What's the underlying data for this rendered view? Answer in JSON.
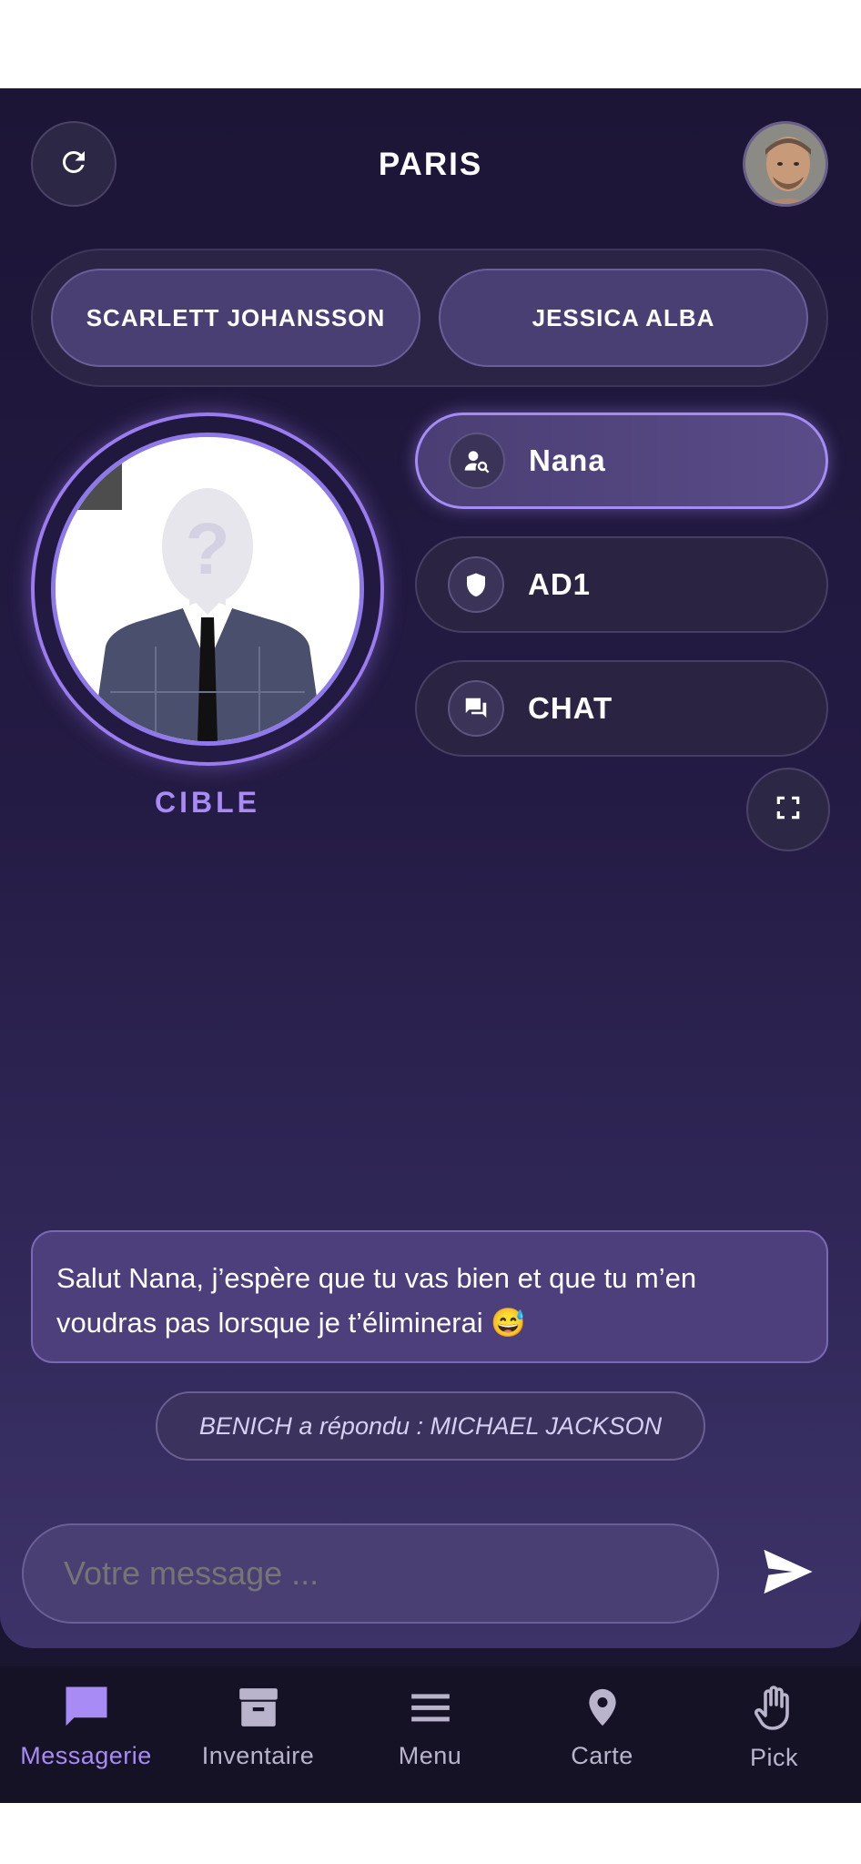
{
  "header": {
    "title": "PARIS",
    "refresh_icon": "refresh-icon",
    "avatar_icon": "user-avatar"
  },
  "targets": [
    {
      "label": "SCARLETT JOHANSSON"
    },
    {
      "label": "JESSICA ALBA"
    }
  ],
  "cible": {
    "label": "CIBLE",
    "image": "unknown-person-silhouette"
  },
  "side_buttons": [
    {
      "label": "Nana",
      "icon": "person-search-icon",
      "active": true
    },
    {
      "label": "AD1",
      "icon": "shield-icon",
      "active": false
    },
    {
      "label": "CHAT",
      "icon": "chat-icon",
      "active": false
    }
  ],
  "expand_icon": "fullscreen-icon",
  "message": {
    "text": "Salut Nana, j’espère que tu vas bien et que tu m’en voudras pas lorsque je t’éliminerai 😅"
  },
  "reply": {
    "text": "BENICH a répondu : MICHAEL JACKSON"
  },
  "composer": {
    "placeholder": "Votre message ...",
    "send_icon": "send-icon"
  },
  "nav": [
    {
      "label": "Messagerie",
      "icon": "message-icon",
      "active": true
    },
    {
      "label": "Inventaire",
      "icon": "archive-icon",
      "active": false
    },
    {
      "label": "Menu",
      "icon": "menu-icon",
      "active": false
    },
    {
      "label": "Carte",
      "icon": "map-pin-icon",
      "active": false
    },
    {
      "label": "Pick",
      "icon": "hand-icon",
      "active": false
    }
  ],
  "colors": {
    "accent": "#a88bf5",
    "background": "#1c1536",
    "nav_background": "#161225"
  }
}
